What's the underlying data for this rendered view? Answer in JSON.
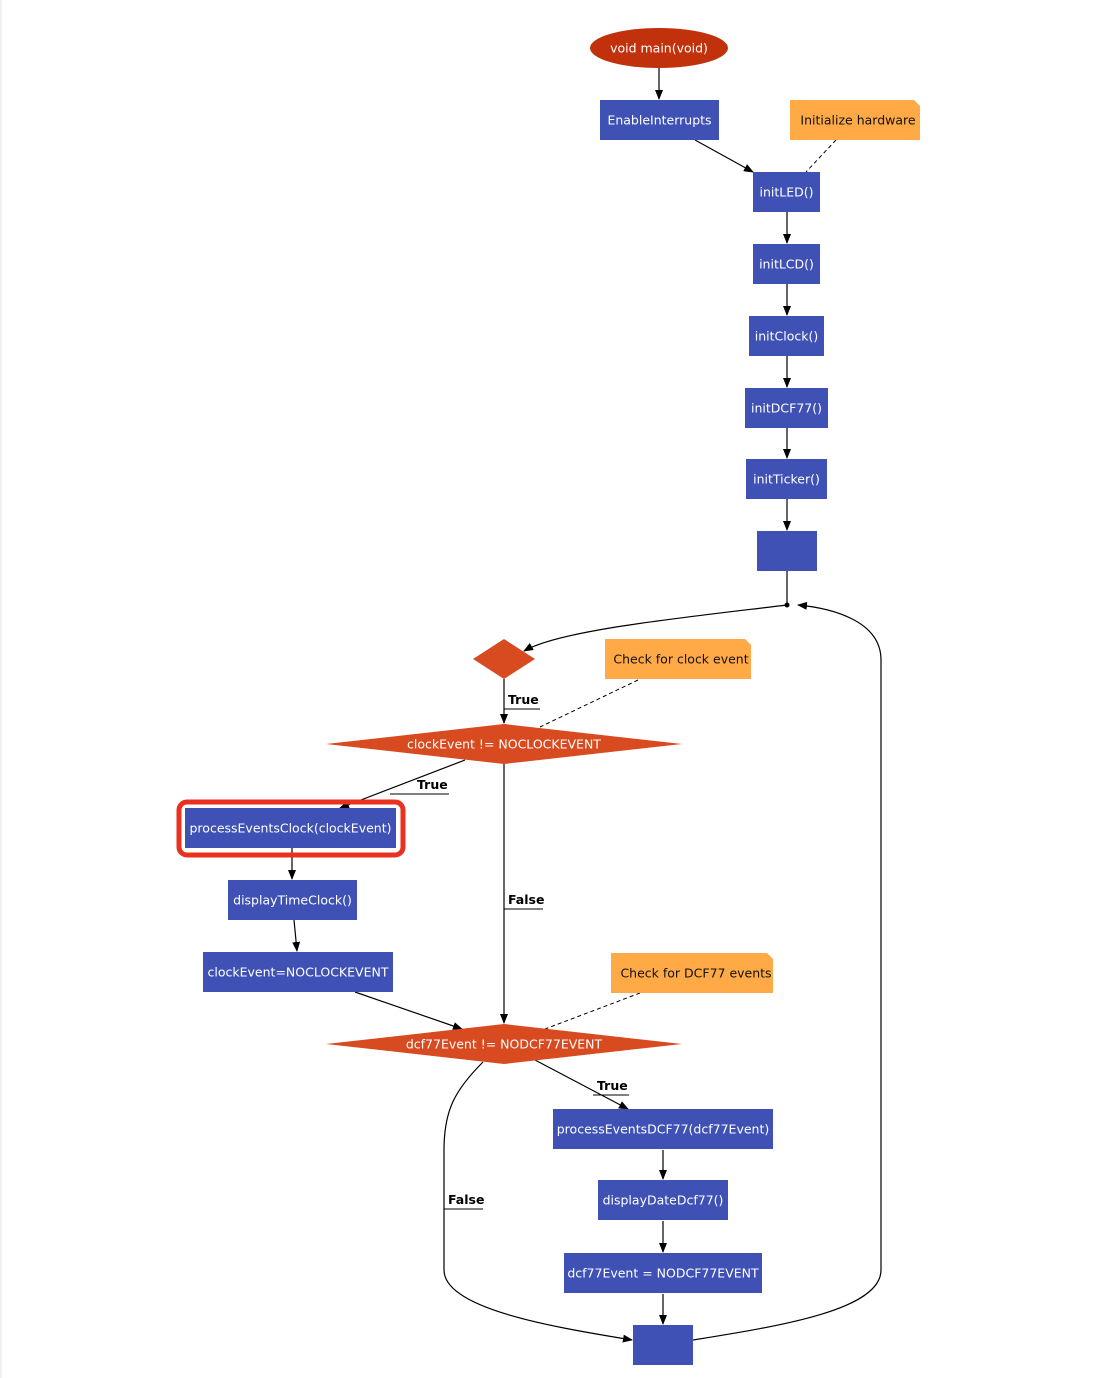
{
  "colors": {
    "process": "#3f51b5",
    "note": "#ffaa47",
    "decision": "#d84a20",
    "start": "#c1310c",
    "highlight": "#e8321f"
  },
  "nodes": {
    "start": "void main(void)",
    "enable_interrupts": "EnableInterrupts",
    "init_led": "initLED()",
    "init_lcd": "initLCD()",
    "init_clock": "initClock()",
    "init_dcf77": "initDCF77()",
    "init_ticker": "initTicker()",
    "clock_decision": "clockEvent != NOCLOCKEVENT",
    "process_clock": "processEventsClock(clockEvent)",
    "display_time": "displayTimeClock()",
    "reset_clock": "clockEvent=NOCLOCKEVENT",
    "dcf_decision": "dcf77Event != NODCF77EVENT",
    "process_dcf": "processEventsDCF77(dcf77Event)",
    "display_date": "displayDateDcf77()",
    "reset_dcf": "dcf77Event = NODCF77EVENT"
  },
  "notes": {
    "init_hw": "Initialize hardware",
    "check_clock": "Check for clock event",
    "check_dcf": "Check for DCF77 events"
  },
  "edge_labels": {
    "loop_true": "True",
    "clock_true": "True",
    "clock_false": "False",
    "dcf_true": "True",
    "dcf_false": "False"
  }
}
